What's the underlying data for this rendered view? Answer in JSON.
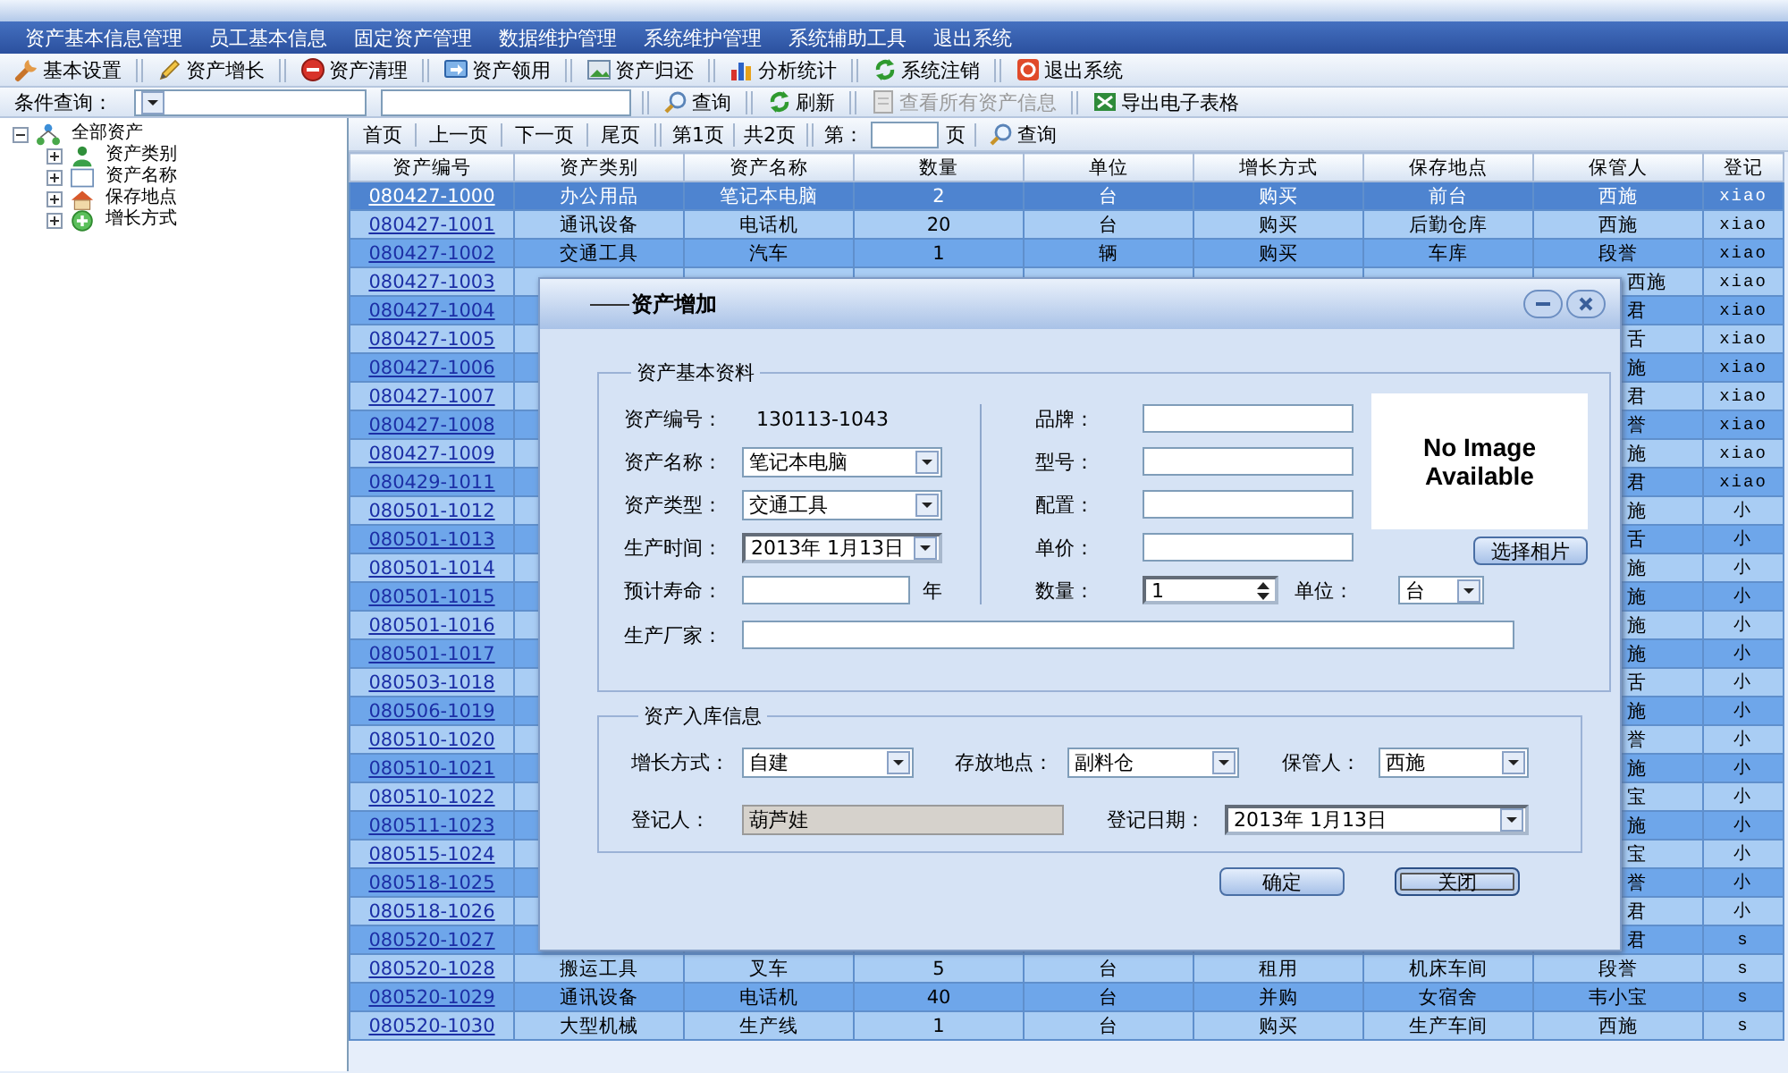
{
  "menu": [
    "资产基本信息管理",
    "员工基本信息",
    "固定资产管理",
    "数据维护管理",
    "系统维护管理",
    "系统辅助工具",
    "退出系统"
  ],
  "toolbar": [
    "基本设置",
    "资产增长",
    "资产清理",
    "资产领用",
    "资产归还",
    "分析统计",
    "系统注销",
    "退出系统"
  ],
  "search_bar": {
    "label": "条件查询：",
    "buttons": [
      {
        "label": "查询",
        "disabled": false
      },
      {
        "label": "刷新",
        "disabled": false
      },
      {
        "label": "查看所有资产信息",
        "disabled": true
      },
      {
        "label": "导出电子表格",
        "disabled": false
      }
    ]
  },
  "tree": {
    "label": "全部资产",
    "expanded": true,
    "children": [
      {
        "label": "资产类别",
        "expanded": false
      },
      {
        "label": "资产名称",
        "expanded": false
      },
      {
        "label": "保存地点",
        "expanded": false
      },
      {
        "label": "增长方式",
        "expanded": false
      }
    ]
  },
  "pager": {
    "buttons": [
      "首页",
      "上一页",
      "下一页",
      "尾页"
    ],
    "current": "第1页",
    "total": "共2页",
    "goto_label": "第：",
    "goto_suffix": "页",
    "query": "查询"
  },
  "table": {
    "columns": [
      "资产编号",
      "资产类别",
      "资产名称",
      "数量",
      "单位",
      "增长方式",
      "保存地点",
      "保管人",
      "登记"
    ],
    "rows": [
      {
        "code": "080427-1000",
        "category": "办公用品",
        "name": "笔记本电脑",
        "quantity": "2",
        "unit": "台",
        "growth": "购买",
        "location": "前台",
        "keeper": "西施",
        "registrar": "xiao",
        "selected": true
      },
      {
        "code": "080427-1001",
        "category": "通讯设备",
        "name": "电话机",
        "quantity": "20",
        "unit": "台",
        "growth": "购买",
        "location": "后勤仓库",
        "keeper": "西施",
        "registrar": "xiao",
        "selected": false
      },
      {
        "code": "080427-1002",
        "category": "交通工具",
        "name": "汽车",
        "quantity": "1",
        "unit": "辆",
        "growth": "购买",
        "location": "车库",
        "keeper": "段誉",
        "registrar": "xiao",
        "selected": false
      },
      {
        "code": "080427-1003",
        "keeper": "西施",
        "registrar": "xiao",
        "selected": false
      },
      {
        "code": "080427-1004",
        "keeper": "君",
        "registrar": "xiao",
        "selected": false
      },
      {
        "code": "080427-1005",
        "keeper": "舌",
        "registrar": "xiao",
        "selected": false
      },
      {
        "code": "080427-1006",
        "keeper": "施",
        "registrar": "xiao",
        "selected": false
      },
      {
        "code": "080427-1007",
        "keeper": "君",
        "registrar": "xiao",
        "selected": false
      },
      {
        "code": "080427-1008",
        "keeper": "誉",
        "registrar": "xiao",
        "selected": false
      },
      {
        "code": "080427-1009",
        "keeper": "施",
        "registrar": "xiao",
        "selected": false
      },
      {
        "code": "080429-1011",
        "keeper": "君",
        "registrar": "xiao",
        "selected": false
      },
      {
        "code": "080501-1012",
        "keeper": "施",
        "registrar": "小",
        "selected": false
      },
      {
        "code": "080501-1013",
        "keeper": "舌",
        "registrar": "小",
        "selected": false
      },
      {
        "code": "080501-1014",
        "keeper": "施",
        "registrar": "小",
        "selected": false
      },
      {
        "code": "080501-1015",
        "keeper": "施",
        "registrar": "小",
        "selected": false
      },
      {
        "code": "080501-1016",
        "keeper": "施",
        "registrar": "小",
        "selected": false
      },
      {
        "code": "080501-1017",
        "keeper": "施",
        "registrar": "小",
        "selected": false
      },
      {
        "code": "080503-1018",
        "keeper": "舌",
        "registrar": "小",
        "selected": false
      },
      {
        "code": "080506-1019",
        "keeper": "施",
        "registrar": "小",
        "selected": false
      },
      {
        "code": "080510-1020",
        "keeper": "誉",
        "registrar": "小",
        "selected": false
      },
      {
        "code": "080510-1021",
        "keeper": "施",
        "registrar": "小",
        "selected": false
      },
      {
        "code": "080510-1022",
        "keeper": "宝",
        "registrar": "小",
        "selected": false
      },
      {
        "code": "080511-1023",
        "keeper": "施",
        "registrar": "小",
        "selected": false
      },
      {
        "code": "080515-1024",
        "keeper": "宝",
        "registrar": "小",
        "selected": false
      },
      {
        "code": "080518-1025",
        "keeper": "誉",
        "registrar": "小",
        "selected": false
      },
      {
        "code": "080518-1026",
        "keeper": "君",
        "registrar": "小",
        "selected": false
      },
      {
        "code": "080520-1027",
        "keeper": "君",
        "registrar": "s",
        "selected": false
      },
      {
        "code": "080520-1028",
        "category": "搬运工具",
        "name": "叉车",
        "quantity": "5",
        "unit": "台",
        "growth": "租用",
        "location": "机床车间",
        "keeper": "段誉",
        "registrar": "s",
        "selected": false
      },
      {
        "code": "080520-1029",
        "category": "通讯设备",
        "name": "电话机",
        "quantity": "40",
        "unit": "台",
        "growth": "并购",
        "location": "女宿舍",
        "keeper": "韦小宝",
        "registrar": "s",
        "selected": false
      },
      {
        "code": "080520-1030",
        "category": "大型机械",
        "name": "生产线",
        "quantity": "1",
        "unit": "台",
        "growth": "购买",
        "location": "生产车间",
        "keeper": "西施",
        "registrar": "s",
        "selected": false
      }
    ]
  },
  "dialog": {
    "title": "资产增加",
    "basic": {
      "title": "资产基本资料",
      "left": [
        {
          "label": "资产编号：",
          "kind": "static",
          "value": "130113-1043"
        },
        {
          "label": "资产名称：",
          "kind": "combo",
          "value": "笔记本电脑"
        },
        {
          "label": "资产类型：",
          "kind": "combo",
          "value": "交通工具"
        },
        {
          "label": "生产时间：",
          "kind": "date",
          "value": "2013年 1月13日"
        },
        {
          "label": "预计寿命：",
          "kind": "input",
          "suffix": "年"
        }
      ],
      "right": [
        {
          "label": "品牌：",
          "kind": "input"
        },
        {
          "label": "型号：",
          "kind": "input"
        },
        {
          "label": "配置：",
          "kind": "input"
        },
        {
          "label": "单价：",
          "kind": "input"
        },
        {
          "label": "数量：",
          "kind": "spinner",
          "value": "1"
        }
      ],
      "unit": {
        "label": "单位：",
        "kind": "combo",
        "value": "台"
      },
      "image_text": "No Image Available",
      "photo_button": "选择相片",
      "manufacturer": {
        "label": "生产厂家：",
        "kind": "input"
      }
    },
    "storage": {
      "title": "资产入库信息",
      "rows": [
        [
          {
            "label": "增长方式：",
            "kind": "combo",
            "value": "自建"
          },
          {
            "label": "存放地点：",
            "kind": "combo",
            "value": "副料仓"
          },
          {
            "label": "保管人：",
            "kind": "combo",
            "value": "西施"
          }
        ],
        [
          {
            "label": "登记人：",
            "kind": "readonly",
            "value": "葫芦娃"
          },
          {
            "label": "登记日期：",
            "kind": "date",
            "value": "2013年 1月13日"
          }
        ]
      ]
    },
    "buttons": [
      {
        "label": "确定",
        "focused": false
      },
      {
        "label": "关闭",
        "focused": true
      }
    ]
  }
}
